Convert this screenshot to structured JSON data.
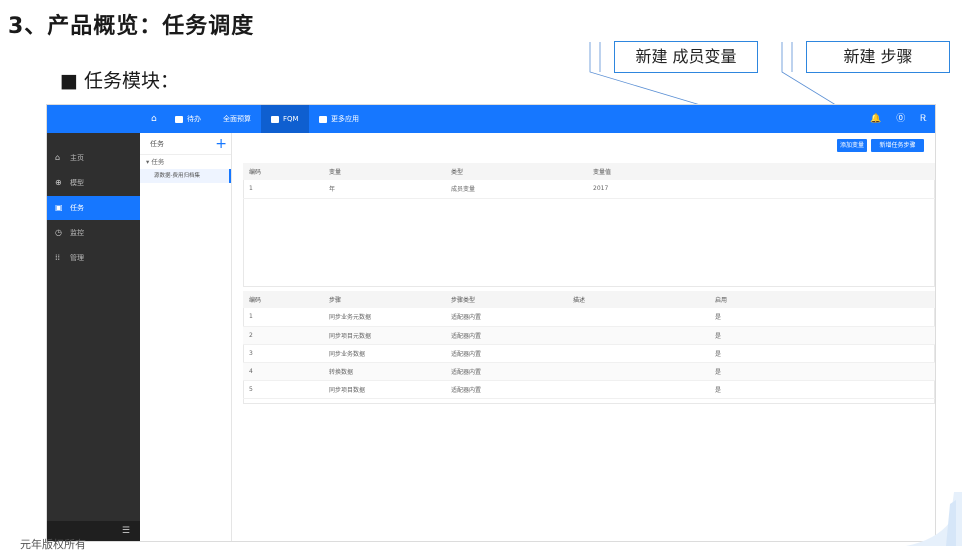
{
  "slide": {
    "title": "3、产品概览：任务调度",
    "subtitle": "■ 任务模块：",
    "footer": "元年版权所有"
  },
  "callouts": {
    "new_member_variable": "新建 成员变量",
    "new_step": "新建 步骤"
  },
  "app": {
    "topbar": {
      "home": "",
      "todo": "待办",
      "all_budget": "全面预算",
      "fqm": "FQM",
      "more_apps": "更多应用",
      "bell": "🔔",
      "help": "⓪",
      "user": "Ꭱ"
    },
    "sidenav": [
      {
        "icon": "⌂",
        "label": "主页"
      },
      {
        "icon": "⊕",
        "label": "模型"
      },
      {
        "icon": "▣",
        "label": "任务"
      },
      {
        "icon": "◷",
        "label": "监控"
      },
      {
        "icon": "⁞⁞",
        "label": "管理"
      }
    ],
    "sidenav_footer": "☰",
    "tree": {
      "header": "任务",
      "plus": "+",
      "node": "▾ 任务",
      "leaf": "源数据-费用归档集"
    },
    "buttons": {
      "add_variable": "添加变量",
      "add_step": "新增任务步骤"
    },
    "variables_table": {
      "headers": [
        "编码",
        "变量",
        "类型",
        "变量值"
      ],
      "rows": [
        [
          "1",
          "年",
          "成员变量",
          "2017"
        ]
      ]
    },
    "steps_table": {
      "headers": [
        "编码",
        "步骤",
        "步骤类型",
        "描述",
        "启用"
      ],
      "rows": [
        [
          "1",
          "同步业务元数据",
          "适配器内置",
          "",
          "是"
        ],
        [
          "2",
          "同步项目元数据",
          "适配器内置",
          "",
          "是"
        ],
        [
          "3",
          "同步业务数据",
          "适配器内置",
          "",
          "是"
        ],
        [
          "4",
          "转换数据",
          "适配器内置",
          "",
          "是"
        ],
        [
          "5",
          "同步项目数据",
          "适配器内置",
          "",
          "是"
        ]
      ]
    }
  },
  "colors": {
    "accent": "#1677ff",
    "sidenav": "#2f2f2f",
    "callout_border": "#2e86de"
  }
}
